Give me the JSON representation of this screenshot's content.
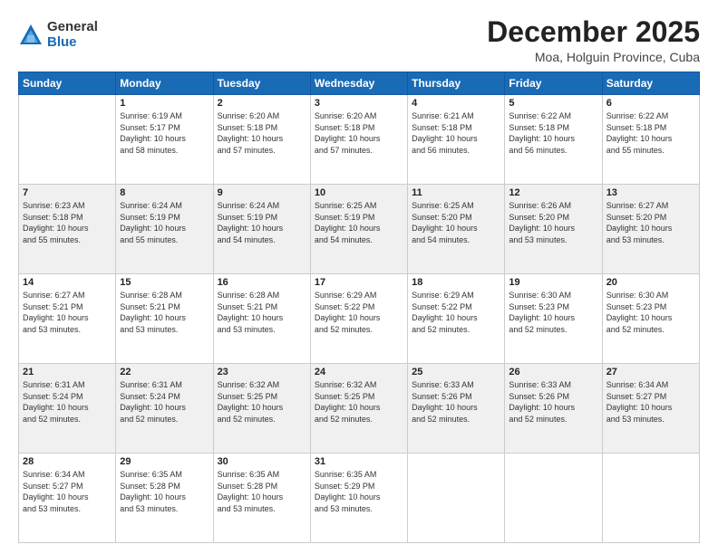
{
  "logo": {
    "general": "General",
    "blue": "Blue"
  },
  "title": "December 2025",
  "location": "Moa, Holguin Province, Cuba",
  "days_of_week": [
    "Sunday",
    "Monday",
    "Tuesday",
    "Wednesday",
    "Thursday",
    "Friday",
    "Saturday"
  ],
  "weeks": [
    [
      {
        "day": "",
        "info": ""
      },
      {
        "day": "1",
        "info": "Sunrise: 6:19 AM\nSunset: 5:17 PM\nDaylight: 10 hours\nand 58 minutes."
      },
      {
        "day": "2",
        "info": "Sunrise: 6:20 AM\nSunset: 5:18 PM\nDaylight: 10 hours\nand 57 minutes."
      },
      {
        "day": "3",
        "info": "Sunrise: 6:20 AM\nSunset: 5:18 PM\nDaylight: 10 hours\nand 57 minutes."
      },
      {
        "day": "4",
        "info": "Sunrise: 6:21 AM\nSunset: 5:18 PM\nDaylight: 10 hours\nand 56 minutes."
      },
      {
        "day": "5",
        "info": "Sunrise: 6:22 AM\nSunset: 5:18 PM\nDaylight: 10 hours\nand 56 minutes."
      },
      {
        "day": "6",
        "info": "Sunrise: 6:22 AM\nSunset: 5:18 PM\nDaylight: 10 hours\nand 55 minutes."
      }
    ],
    [
      {
        "day": "7",
        "info": "Sunrise: 6:23 AM\nSunset: 5:18 PM\nDaylight: 10 hours\nand 55 minutes."
      },
      {
        "day": "8",
        "info": "Sunrise: 6:24 AM\nSunset: 5:19 PM\nDaylight: 10 hours\nand 55 minutes."
      },
      {
        "day": "9",
        "info": "Sunrise: 6:24 AM\nSunset: 5:19 PM\nDaylight: 10 hours\nand 54 minutes."
      },
      {
        "day": "10",
        "info": "Sunrise: 6:25 AM\nSunset: 5:19 PM\nDaylight: 10 hours\nand 54 minutes."
      },
      {
        "day": "11",
        "info": "Sunrise: 6:25 AM\nSunset: 5:20 PM\nDaylight: 10 hours\nand 54 minutes."
      },
      {
        "day": "12",
        "info": "Sunrise: 6:26 AM\nSunset: 5:20 PM\nDaylight: 10 hours\nand 53 minutes."
      },
      {
        "day": "13",
        "info": "Sunrise: 6:27 AM\nSunset: 5:20 PM\nDaylight: 10 hours\nand 53 minutes."
      }
    ],
    [
      {
        "day": "14",
        "info": "Sunrise: 6:27 AM\nSunset: 5:21 PM\nDaylight: 10 hours\nand 53 minutes."
      },
      {
        "day": "15",
        "info": "Sunrise: 6:28 AM\nSunset: 5:21 PM\nDaylight: 10 hours\nand 53 minutes."
      },
      {
        "day": "16",
        "info": "Sunrise: 6:28 AM\nSunset: 5:21 PM\nDaylight: 10 hours\nand 53 minutes."
      },
      {
        "day": "17",
        "info": "Sunrise: 6:29 AM\nSunset: 5:22 PM\nDaylight: 10 hours\nand 52 minutes."
      },
      {
        "day": "18",
        "info": "Sunrise: 6:29 AM\nSunset: 5:22 PM\nDaylight: 10 hours\nand 52 minutes."
      },
      {
        "day": "19",
        "info": "Sunrise: 6:30 AM\nSunset: 5:23 PM\nDaylight: 10 hours\nand 52 minutes."
      },
      {
        "day": "20",
        "info": "Sunrise: 6:30 AM\nSunset: 5:23 PM\nDaylight: 10 hours\nand 52 minutes."
      }
    ],
    [
      {
        "day": "21",
        "info": "Sunrise: 6:31 AM\nSunset: 5:24 PM\nDaylight: 10 hours\nand 52 minutes."
      },
      {
        "day": "22",
        "info": "Sunrise: 6:31 AM\nSunset: 5:24 PM\nDaylight: 10 hours\nand 52 minutes."
      },
      {
        "day": "23",
        "info": "Sunrise: 6:32 AM\nSunset: 5:25 PM\nDaylight: 10 hours\nand 52 minutes."
      },
      {
        "day": "24",
        "info": "Sunrise: 6:32 AM\nSunset: 5:25 PM\nDaylight: 10 hours\nand 52 minutes."
      },
      {
        "day": "25",
        "info": "Sunrise: 6:33 AM\nSunset: 5:26 PM\nDaylight: 10 hours\nand 52 minutes."
      },
      {
        "day": "26",
        "info": "Sunrise: 6:33 AM\nSunset: 5:26 PM\nDaylight: 10 hours\nand 52 minutes."
      },
      {
        "day": "27",
        "info": "Sunrise: 6:34 AM\nSunset: 5:27 PM\nDaylight: 10 hours\nand 53 minutes."
      }
    ],
    [
      {
        "day": "28",
        "info": "Sunrise: 6:34 AM\nSunset: 5:27 PM\nDaylight: 10 hours\nand 53 minutes."
      },
      {
        "day": "29",
        "info": "Sunrise: 6:35 AM\nSunset: 5:28 PM\nDaylight: 10 hours\nand 53 minutes."
      },
      {
        "day": "30",
        "info": "Sunrise: 6:35 AM\nSunset: 5:28 PM\nDaylight: 10 hours\nand 53 minutes."
      },
      {
        "day": "31",
        "info": "Sunrise: 6:35 AM\nSunset: 5:29 PM\nDaylight: 10 hours\nand 53 minutes."
      },
      {
        "day": "",
        "info": ""
      },
      {
        "day": "",
        "info": ""
      },
      {
        "day": "",
        "info": ""
      }
    ]
  ]
}
